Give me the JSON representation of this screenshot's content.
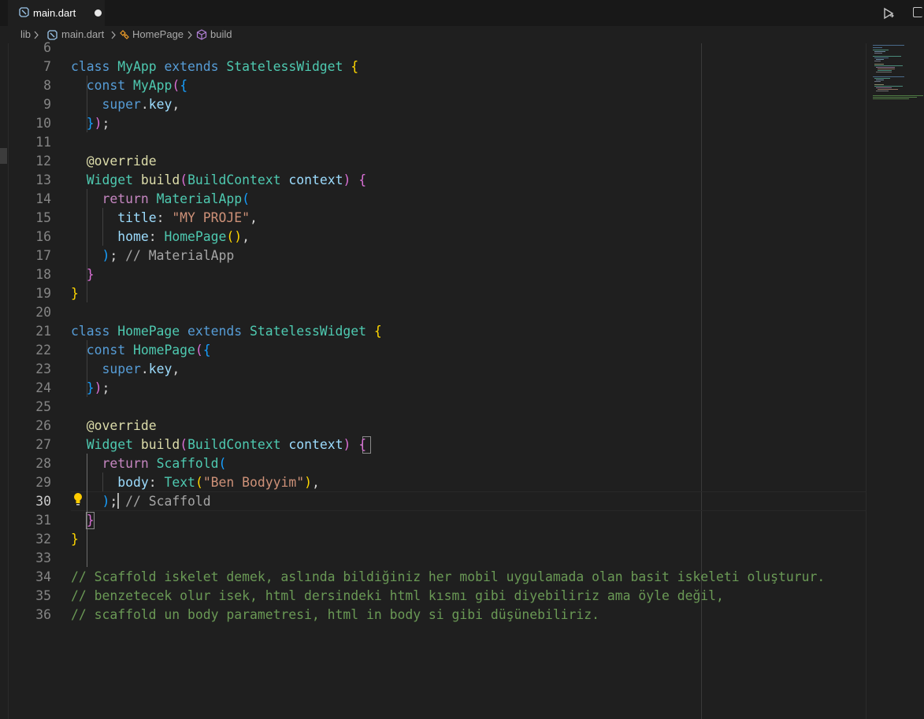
{
  "tab": {
    "label": "main.dart",
    "icon": "dart-file-icon",
    "modified": true
  },
  "tab_actions": {
    "run_icon": "run-debug-icon",
    "split_icon": "split-editor-icon"
  },
  "breadcrumb": {
    "folder": "lib",
    "file": "main.dart",
    "class": "HomePage",
    "method": "build"
  },
  "editor": {
    "active_line": 30,
    "line_numbers": [
      "6",
      "7",
      "8",
      "9",
      "10",
      "11",
      "12",
      "13",
      "14",
      "15",
      "16",
      "17",
      "18",
      "19",
      "20",
      "21",
      "22",
      "23",
      "24",
      "25",
      "26",
      "27",
      "28",
      "29",
      "30",
      "31",
      "32",
      "33",
      "34",
      "35",
      "36"
    ],
    "code": {
      "l7": {
        "kw": "class",
        "name": "MyApp",
        "ext": "extends",
        "base": "StatelessWidget",
        "open": "{"
      },
      "l8": {
        "kw": "const",
        "ctor": "MyApp",
        "open": "(",
        "brace": "{"
      },
      "l9": {
        "super": "super",
        "dot": ".",
        "key": "key",
        "comma": ","
      },
      "l10": {
        "close": "}",
        "paren": ")",
        "semi": ";"
      },
      "l12": {
        "ann": "@override"
      },
      "l13": {
        "type": "Widget",
        "fn": "build",
        "open": "(",
        "ptype": "BuildContext",
        "pname": "context",
        "close": ")",
        "brace": "{"
      },
      "l14": {
        "ret": "return",
        "cls": "MaterialApp",
        "open": "("
      },
      "l15": {
        "param": "title",
        "colon": ": ",
        "str": "\"MY PROJE\"",
        "comma": ","
      },
      "l16": {
        "param": "home",
        "colon": ": ",
        "cls": "HomePage",
        "parens": "()",
        "comma": ","
      },
      "l17": {
        "close": ")",
        "semi": ";",
        "cmt": "// MaterialApp"
      },
      "l18": {
        "close": "}"
      },
      "l19": {
        "close": "}"
      },
      "l21": {
        "kw": "class",
        "name": "HomePage",
        "ext": "extends",
        "base": "StatelessWidget",
        "open": "{"
      },
      "l22": {
        "kw": "const",
        "ctor": "HomePage",
        "open": "(",
        "brace": "{"
      },
      "l23": {
        "super": "super",
        "dot": ".",
        "key": "key",
        "comma": ","
      },
      "l24": {
        "close": "}",
        "paren": ")",
        "semi": ";"
      },
      "l26": {
        "ann": "@override"
      },
      "l27": {
        "type": "Widget",
        "fn": "build",
        "open": "(",
        "ptype": "BuildContext",
        "pname": "context",
        "close": ")",
        "brace": "{"
      },
      "l28": {
        "ret": "return",
        "cls": "Scaffold",
        "open": "("
      },
      "l29": {
        "param": "body",
        "colon": ": ",
        "cls": "Text",
        "open": "(",
        "str": "\"Ben Bodyyim\"",
        "close": ")",
        "comma": ","
      },
      "l30": {
        "close": ")",
        "semi": ";",
        "cmt": "// Scaffold"
      },
      "l31": {
        "close": "}"
      },
      "l32": {
        "close": "}"
      },
      "l34": "// Scaffold iskelet demek, aslında bildiğiniz her mobil uygulamada olan basit iskeleti oluşturur.",
      "l35": "// benzetecek olur isek, html dersindeki html kısmı gibi diyebiliriz ama öyle değil,",
      "l36": "// scaffold un body parametresi, html in body si gibi düşünebiliriz."
    },
    "lightbulb_icon": "lightbulb-icon"
  },
  "colors": {
    "background": "#1f1f1f",
    "keyword": "#569cd6",
    "class": "#4ec9b0",
    "function": "#dcdcaa",
    "string": "#ce9178",
    "comment": "#6a9955",
    "bracket_gold": "#ffd700",
    "bracket_pink": "#da70d6",
    "bracket_blue": "#179fff"
  }
}
